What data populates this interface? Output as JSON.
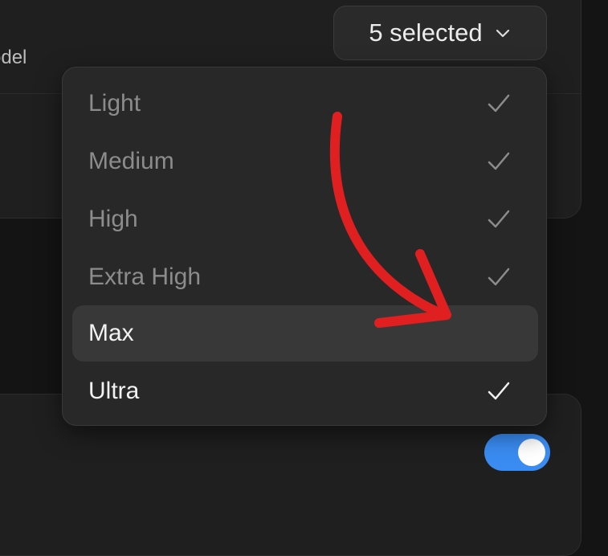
{
  "model_label": "odel",
  "select": {
    "label": "5 selected",
    "chevron_icon": "chevron-down-icon"
  },
  "options": [
    {
      "label": "Light",
      "selected": true
    },
    {
      "label": "Medium",
      "selected": true
    },
    {
      "label": "High",
      "selected": true
    },
    {
      "label": "Extra High",
      "selected": true
    },
    {
      "label": "Max",
      "selected": false,
      "highlighted": true
    },
    {
      "label": "Ultra",
      "selected": true
    }
  ],
  "toggle": {
    "on": true
  },
  "annotation": {
    "icon": "curved-arrow-icon",
    "color": "#e02020"
  },
  "colors": {
    "accent": "#3a8cf2",
    "annotation": "#e02020"
  }
}
